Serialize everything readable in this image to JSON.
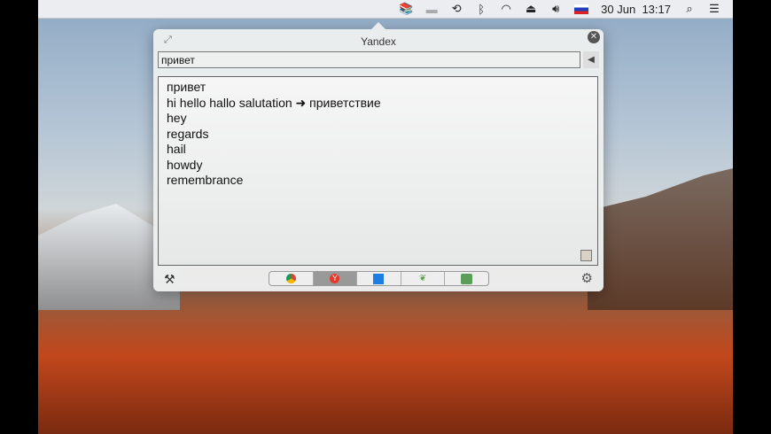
{
  "menubar": {
    "date": "30 Jun",
    "time": "13:17"
  },
  "popup": {
    "title": "Yandex",
    "input_value": "привет",
    "results": [
      "привет",
      "hi  hello  hallo  salutation ➜ приветствие",
      "hey",
      "regards",
      "hail",
      "howdy",
      "remembrance"
    ],
    "services": [
      {
        "name": "google",
        "color": "#4285f4"
      },
      {
        "name": "yandex",
        "color": "#e53b2c"
      },
      {
        "name": "bing",
        "color": "#1e7de0"
      },
      {
        "name": "service4",
        "color": "#5aa34a"
      },
      {
        "name": "service5",
        "color": "#5a9e5a"
      }
    ],
    "selected_service": "yandex"
  }
}
